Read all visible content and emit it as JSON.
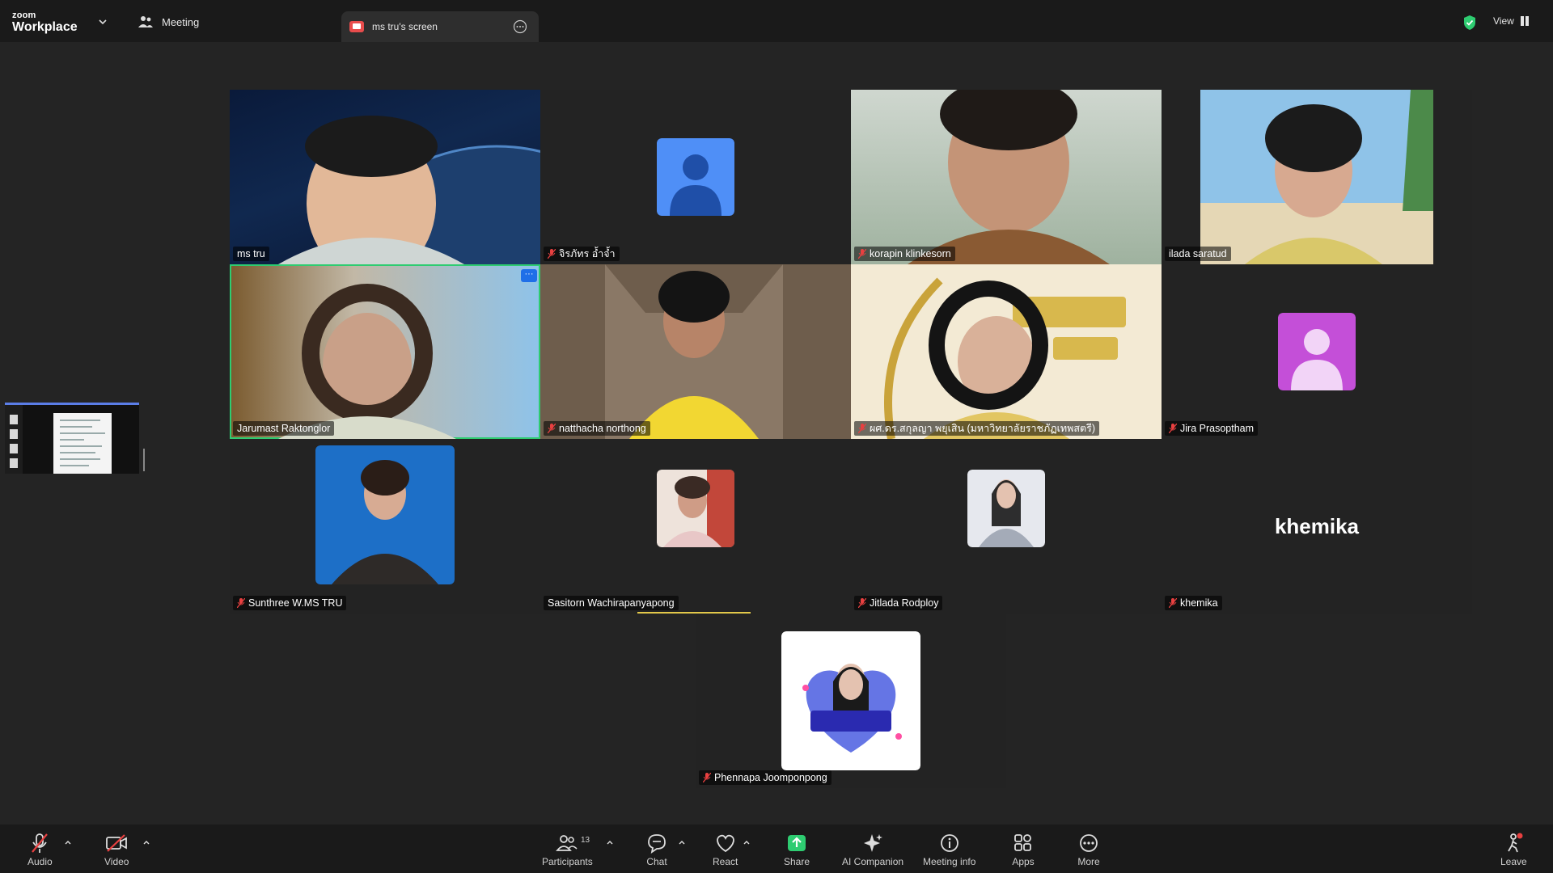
{
  "app": {
    "brand_small": "zoom",
    "brand_large": "Workplace"
  },
  "tabs": {
    "meeting": "Meeting",
    "screen": "ms tru's screen"
  },
  "header": {
    "view_label": "View"
  },
  "colors": {
    "accent_green": "#2ecc71",
    "share_green": "#2ecc71",
    "mute_red": "#e84040",
    "avatar_blue": "#4f8ff7",
    "avatar_magenta": "#c44fd8"
  },
  "participants": [
    {
      "name": "ms tru",
      "muted": false
    },
    {
      "name": "จิรภัทร อ้ำจ้ำ",
      "muted": true
    },
    {
      "name": "korapin klinkesorn",
      "muted": true
    },
    {
      "name": "ilada saratud",
      "muted": false
    },
    {
      "name": "Jarumast Raktonglor",
      "muted": false,
      "speaking": true
    },
    {
      "name": "natthacha northong",
      "muted": true
    },
    {
      "name": "ผศ.ดร.สกุลญา พยุเสิน (มหาวิทยาลัยราชภัฏเทพสตรี)",
      "muted": true
    },
    {
      "name": "Jira Prasoptham",
      "muted": true
    },
    {
      "name": "Sunthree W.MS TRU",
      "muted": true
    },
    {
      "name": "Sasitorn Wachirapanyapong",
      "muted": false
    },
    {
      "name": "Jitlada Rodploy",
      "muted": true
    },
    {
      "name": "khemika",
      "muted": true,
      "display_name": "khemika"
    },
    {
      "name": "Phennapa Joomponpong",
      "muted": true
    }
  ],
  "toolbar": {
    "audio": "Audio",
    "video": "Video",
    "participants": "Participants",
    "participants_count": "13",
    "chat": "Chat",
    "react": "React",
    "share": "Share",
    "ai_companion": "AI Companion",
    "meeting_info": "Meeting info",
    "apps": "Apps",
    "more": "More",
    "leave": "Leave"
  },
  "icons": {
    "audio": "mic-off-icon",
    "video": "video-off-icon",
    "participants": "people-icon",
    "chat": "chat-bubble-icon",
    "react": "heart-icon",
    "share": "share-up-arrow-icon",
    "ai_companion": "sparkle-icon",
    "meeting_info": "info-icon",
    "apps": "apps-icon",
    "more": "more-dots-icon",
    "leave": "leave-icon"
  }
}
